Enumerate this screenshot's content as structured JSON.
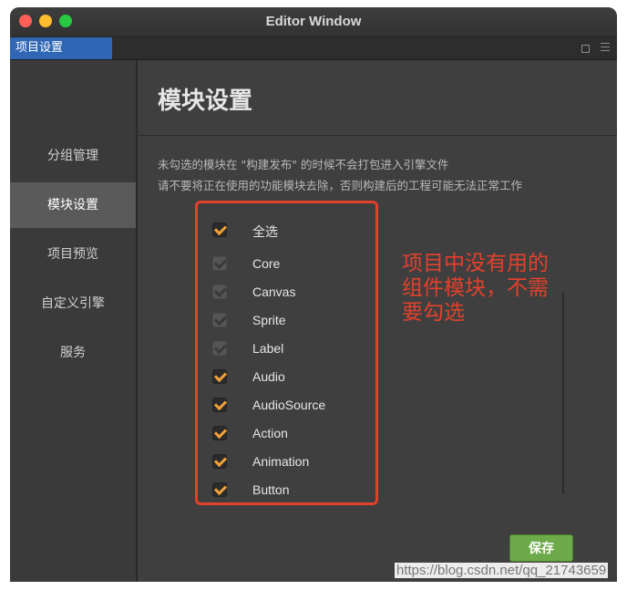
{
  "window": {
    "title": "Editor Window"
  },
  "tabbar": {
    "active_tab": "项目设置"
  },
  "sidebar": {
    "items": [
      {
        "label": "分组管理"
      },
      {
        "label": "模块设置"
      },
      {
        "label": "项目预览"
      },
      {
        "label": "自定义引擎"
      },
      {
        "label": "服务"
      }
    ],
    "active_index": 1
  },
  "main": {
    "title": "模块设置",
    "desc_line1": "未勾选的模块在 \"构建发布\" 的时候不会打包进入引擎文件",
    "desc_line2": "请不要将正在使用的功能模块去除，否则构建后的工程可能无法正常工作",
    "select_all_label": "全选",
    "modules": [
      {
        "label": "Core",
        "checked": true,
        "disabled": true
      },
      {
        "label": "Canvas",
        "checked": true,
        "disabled": true
      },
      {
        "label": "Sprite",
        "checked": true,
        "disabled": true
      },
      {
        "label": "Label",
        "checked": true,
        "disabled": true
      },
      {
        "label": "Audio",
        "checked": true,
        "disabled": false
      },
      {
        "label": "AudioSource",
        "checked": true,
        "disabled": false
      },
      {
        "label": "Action",
        "checked": true,
        "disabled": false
      },
      {
        "label": "Animation",
        "checked": true,
        "disabled": false
      },
      {
        "label": "Button",
        "checked": true,
        "disabled": false
      }
    ],
    "save_label": "保存"
  },
  "annotation": {
    "line1": "项目中没有用的",
    "line2": "组件模块，不需",
    "line3": "要勾选"
  },
  "watermark": "https://blog.csdn.net/qq_21743659",
  "colors": {
    "accent_tab": "#2f67b5",
    "check_orange": "#f2a13a",
    "annotation_red": "#e2412c",
    "save_green": "#6dab4a"
  }
}
